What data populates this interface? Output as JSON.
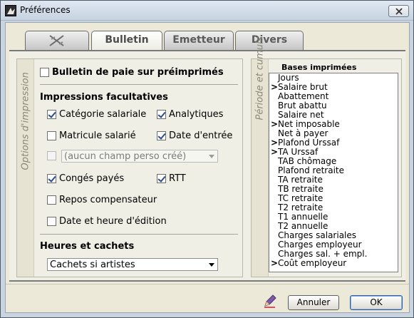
{
  "window": {
    "title": "Préférences"
  },
  "tabs": [
    {
      "label": ""
    },
    {
      "label": "Bulletin"
    },
    {
      "label": "Emetteur"
    },
    {
      "label": "Divers"
    }
  ],
  "left_panel": {
    "vertical_label": "Options d'impression",
    "preprint_label": "Bulletin de paie sur préimprimés",
    "preprint_checked": false,
    "optional_title": "Impressions facultatives",
    "options": {
      "categorie": {
        "label": "Catégorie salariale",
        "checked": true
      },
      "analytiques": {
        "label": "Analytiques",
        "checked": true
      },
      "matricule": {
        "label": "Matricule salarié",
        "checked": false
      },
      "date_entree": {
        "label": "Date d'entrée",
        "checked": true
      },
      "perso": {
        "label": "(aucun champ perso créé)",
        "checked": false,
        "disabled": true
      },
      "conges": {
        "label": "Congés payés",
        "checked": true
      },
      "rtt": {
        "label": "RTT",
        "checked": true
      },
      "repos": {
        "label": "Repos compensateur",
        "checked": false
      },
      "date_edition": {
        "label": "Date et heure d'édition",
        "checked": false
      }
    },
    "hours_title": "Heures et cachets",
    "hours_select": "Cachets si artistes"
  },
  "right_panel": {
    "vertical_label": "Période et cumuls",
    "list_header": "Bases imprimées",
    "items": [
      {
        "label": "Jours",
        "marked": false
      },
      {
        "label": "Salaire brut",
        "marked": true
      },
      {
        "label": "Abattement",
        "marked": false
      },
      {
        "label": "Brut abattu",
        "marked": false
      },
      {
        "label": "Salaire net",
        "marked": false
      },
      {
        "label": "Net imposable",
        "marked": true
      },
      {
        "label": "Net à payer",
        "marked": false
      },
      {
        "label": "Plafond Urssaf",
        "marked": true
      },
      {
        "label": "TA Urssaf",
        "marked": true
      },
      {
        "label": "TAB chômage",
        "marked": false
      },
      {
        "label": "Plafond retraite",
        "marked": false
      },
      {
        "label": "TA retraite",
        "marked": false
      },
      {
        "label": "TB retraite",
        "marked": false
      },
      {
        "label": "TC retraite",
        "marked": false
      },
      {
        "label": "T2 retraite",
        "marked": false
      },
      {
        "label": "T1 annuelle",
        "marked": false
      },
      {
        "label": "T2 annuelle",
        "marked": false
      },
      {
        "label": "Charges salariales",
        "marked": false
      },
      {
        "label": "Charges employeur",
        "marked": false
      },
      {
        "label": "Charges sal. + empl.",
        "marked": false
      },
      {
        "label": "Coût employeur",
        "marked": true
      }
    ],
    "marker_glyph": ">"
  },
  "buttons": {
    "cancel": "Annuler",
    "ok": "OK"
  },
  "colors": {
    "check": "#2a4b8d",
    "ok_border": "#2d5fa8"
  }
}
